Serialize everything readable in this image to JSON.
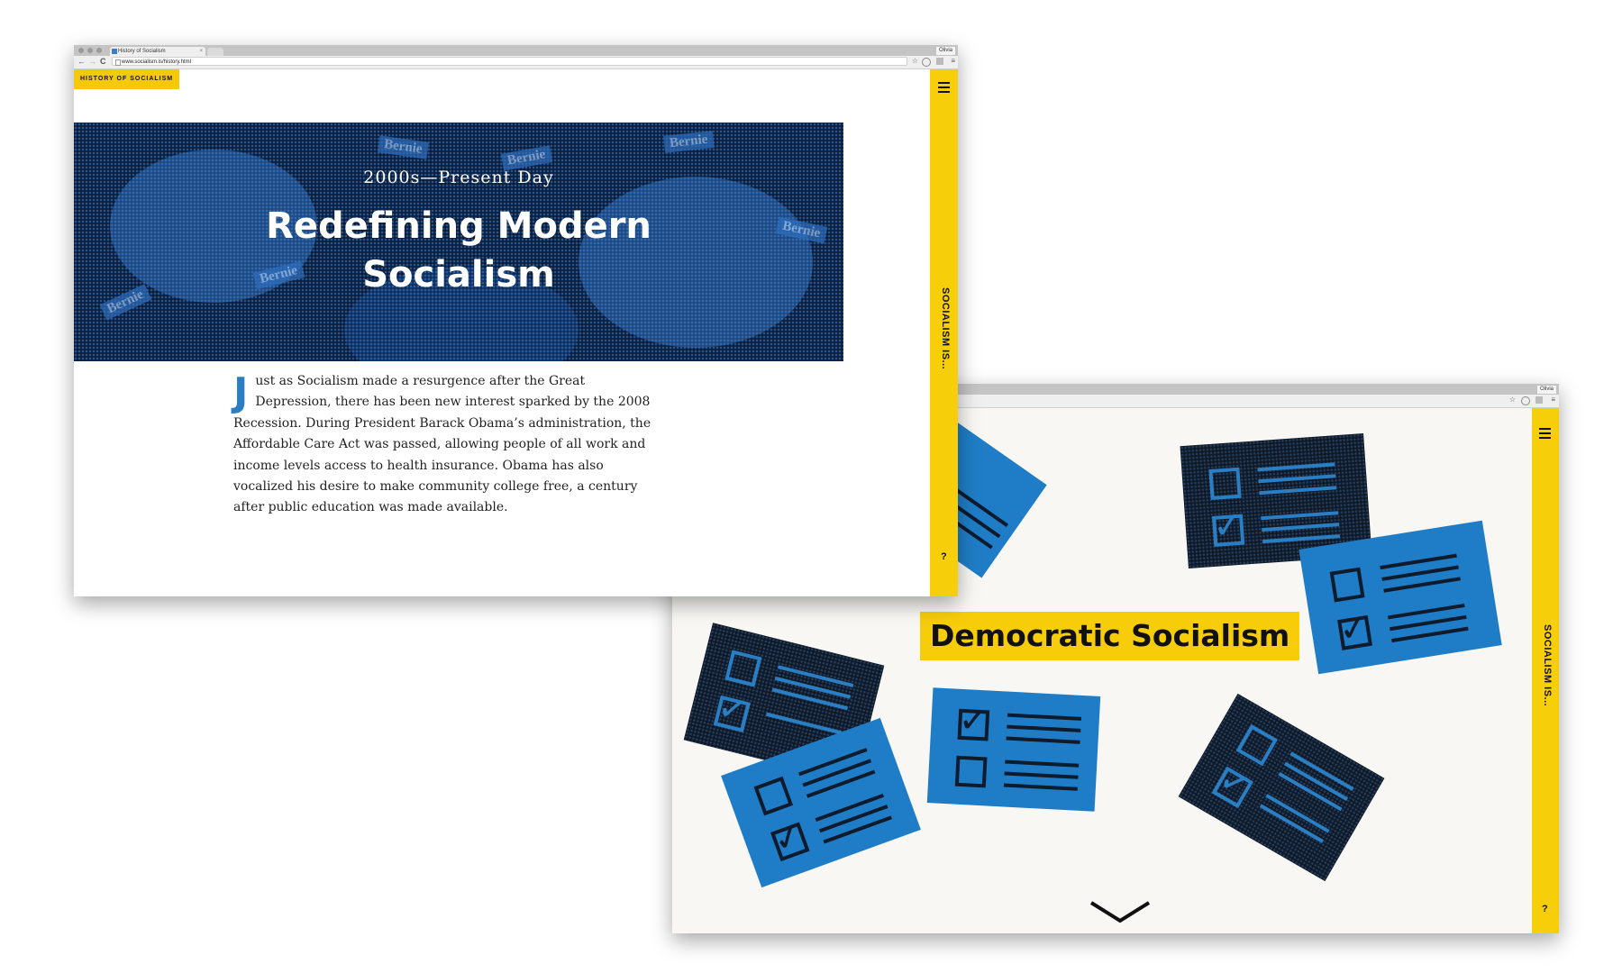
{
  "window_back": {
    "profile": "Olivia",
    "rail_text": "SOCIALISM IS...",
    "qmark": "?",
    "democratic_label": "Democratic Socialism"
  },
  "window_front": {
    "tab_title": "History of Socialism",
    "tab_close": "×",
    "profile": "Olivia",
    "url": "www.socialism.is/history.html",
    "nav": {
      "back": "←",
      "forward": "→",
      "reload": "C"
    },
    "right_icons": {
      "star": "☆",
      "menu": "≡"
    },
    "logo": "HISTORY OF SOCIALISM",
    "rail_text": "SOCIALISM IS...",
    "qmark": "?",
    "hero": {
      "subtitle": "2000s—Present Day",
      "title_line1": "Redefining Modern",
      "title_line2": "Socialism",
      "sign_text": "Bernie"
    },
    "body": {
      "drop_cap": "J",
      "text": "ust as Socialism made a resurgence after the Great Depression, there has been new interest sparked by the 2008 Recession. During President Barack Obama’s administration, the Affordable Care Act was passed, allowing people of all work and income levels access to health insurance. Obama has also vocalized his desire to make community college free, a century after public education was made available."
    }
  },
  "icons": {
    "menu": "hamburger-menu-icon",
    "checkbox": "checkbox-icon",
    "check": "checkmark-icon",
    "scroll_down": "chevron-down-icon",
    "bookmark": "star-icon"
  },
  "colors": {
    "yellow": "#f7ce0a",
    "blue": "#1f7dc7",
    "dark": "#0e1826",
    "hero_bg": "#0c1d3a"
  }
}
